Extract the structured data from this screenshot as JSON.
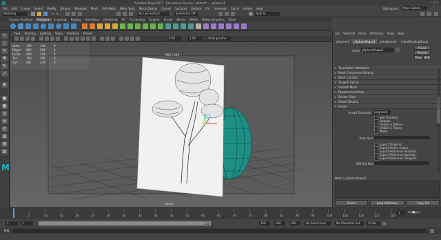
{
  "title_bar": {
    "title": "Autodesk Maya 2017 - Educational Version: untitled*   ---   pSphere1"
  },
  "menu_bar": {
    "items": [
      "File",
      "Edit",
      "Create",
      "Select",
      "Modify",
      "Display",
      "Windows",
      "Mesh",
      "Edit Mesh",
      "Mesh Tools",
      "Mesh Display",
      "Curves",
      "Surfaces",
      "Deform",
      "UV",
      "Generate",
      "Cache",
      "Arnold",
      "Help"
    ]
  },
  "status_line": {
    "mode": "Modeling",
    "camera_field": "No Live Surface",
    "symmetry": "Symmetry: Off",
    "user": "Sign In",
    "workspace_label": "Workspace :",
    "workspace": "Maya Classic"
  },
  "shelf": {
    "tabs": [
      "Curves / Surfaces",
      "Polygons",
      "Sculpting",
      "Rigging",
      "Animation",
      "Rendering",
      "FX",
      "FX Caching",
      "Custom",
      "Arnold",
      "Bifrost",
      "MASH",
      "Motion Graphics",
      "XGen"
    ],
    "active_tab": 1
  },
  "viewport": {
    "menu": [
      "View",
      "Shading",
      "Lighting",
      "Show",
      "Renderer",
      "Panels"
    ],
    "resolution": "960 x 540",
    "hud": [
      {
        "label": "Verts:",
        "a": "439",
        "b": "144",
        "c": "0"
      },
      {
        "label": "Edges:",
        "a": "860",
        "b": "288",
        "c": "0"
      },
      {
        "label": "Faces:",
        "a": "400",
        "b": "144",
        "c": "0"
      },
      {
        "label": "Tris:",
        "a": "760",
        "b": "288",
        "c": "0"
      },
      {
        "label": "UVs:",
        "a": "461",
        "b": "439",
        "c": "0"
      }
    ],
    "camera_label": "persp",
    "tb_value1": "0.00",
    "tb_value2": "1.00",
    "color_space": "sRGB gamma"
  },
  "attribute_editor": {
    "menu": [
      "List",
      "Selected",
      "Focus",
      "Attributes",
      "Show",
      "Help"
    ],
    "tabs": [
      "pSphere1",
      "pSphereShape1",
      "polySphere1",
      "initialShadingGroup"
    ],
    "mesh_label": "mesh:",
    "mesh_value": "pSphereShape1",
    "focus_btn": "Focus",
    "presets_btn": "Presets",
    "show_btn": "Show",
    "hide_btn": "Hide",
    "sections": [
      "Tessellation Attributes",
      "Mesh Component Display",
      "Mesh Controls",
      "Tangent Space",
      "Smooth Mesh",
      "Displacement Map",
      "Render Stats",
      "Object Display",
      "Arnold"
    ],
    "arnold_translator_label": "Arnold Translator",
    "arnold_translator_value": "polymesh",
    "checkboxes_a": [
      "Self Shadows",
      "Opaque",
      "Visible in Diffuse",
      "Visible in Glossy",
      "Matte"
    ],
    "subdiv_label": "Trace Sets",
    "checkboxes_b": [
      "Export Tangents",
      "Export Vertex Colors",
      "Export Reference Positions",
      "Export Reference Normals",
      "Export Reference Tangents"
    ],
    "sss_label": "SSS Set Name",
    "notes_label": "Notes: pSphereShape1",
    "select_btn": "Select",
    "load_btn": "Load Attributes",
    "copy_btn": "Copy Tab"
  },
  "time_slider": {
    "ticks": [
      "1",
      "5",
      "10",
      "15",
      "20",
      "25",
      "30",
      "35",
      "40",
      "45",
      "50",
      "55",
      "60",
      "65",
      "70",
      "75",
      "80",
      "85",
      "90",
      "95",
      "100",
      "105",
      "110",
      "115",
      "120"
    ],
    "current": "1"
  },
  "range_slider": {
    "start": "1",
    "start2": "1",
    "range_label": "120",
    "end1": "120",
    "end2": "200",
    "end3": "200",
    "anim_layer": "No Anim Layer",
    "char_set": "No Character Set",
    "fps": "24 fps"
  },
  "command_line": {
    "label": "MEL"
  },
  "colors": {
    "accent": "#5d9bd4",
    "sphere": "#1e8f85",
    "active_tab": "#595959"
  },
  "icons": [
    "select-icon",
    "lasso-icon",
    "paint-icon",
    "move-icon",
    "rotate-icon",
    "scale-icon"
  ]
}
